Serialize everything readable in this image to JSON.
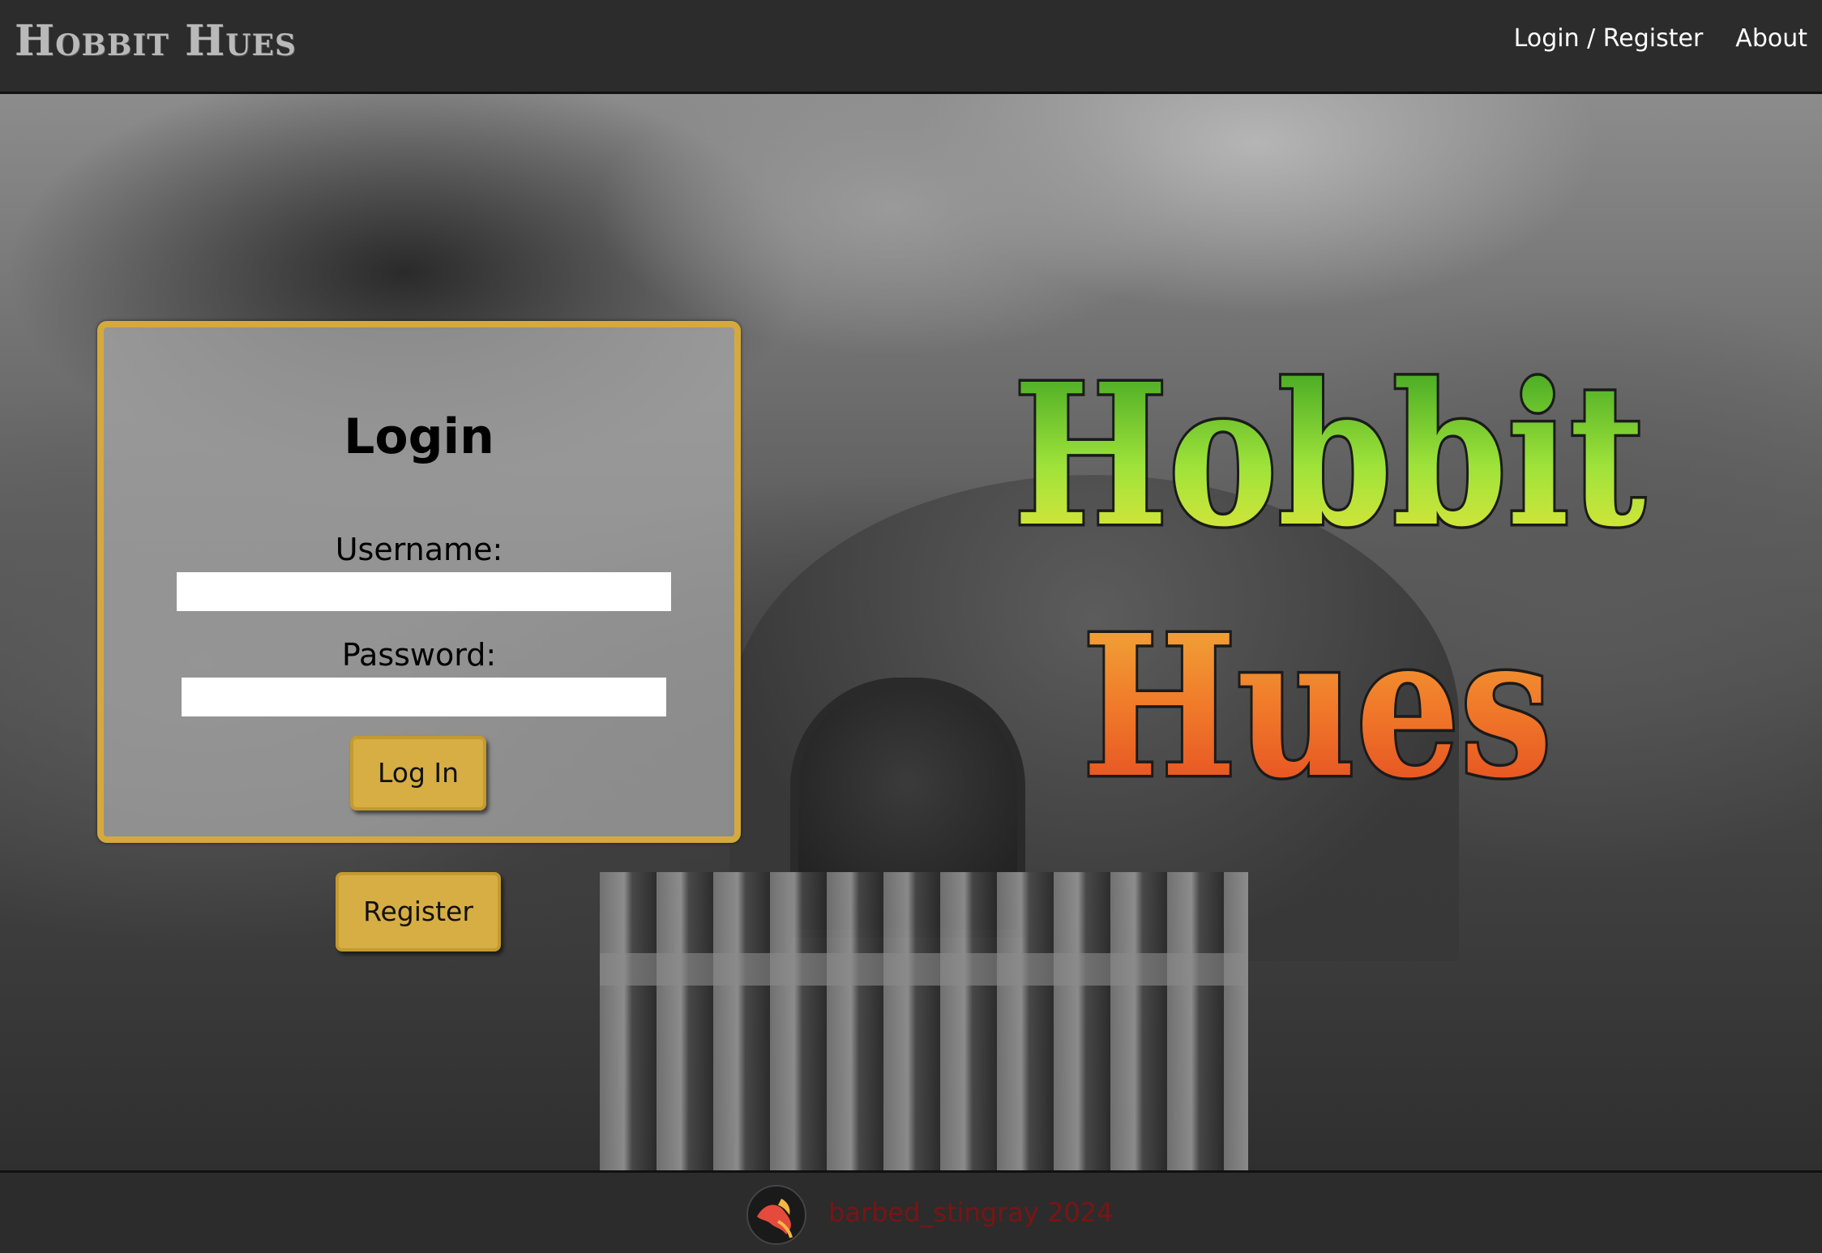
{
  "navbar": {
    "brand": "Hobbit Hues",
    "links": [
      {
        "label": "Login / Register"
      },
      {
        "label": "About"
      }
    ]
  },
  "hero": {
    "logo_line1": "Hobbit",
    "logo_line2": "Hues",
    "logo_colors": {
      "top_gradient": [
        "#2f9a1e",
        "#9fe33a",
        "#f1e53a"
      ],
      "bottom_gradient": [
        "#f0b23a",
        "#f07a2a",
        "#e2441e"
      ],
      "outline": "#1b1b1b"
    }
  },
  "login_form": {
    "title": "Login",
    "username_label": "Username:",
    "username_value": "",
    "password_label": "Password:",
    "password_value": "",
    "login_button": "Log In",
    "register_button": "Register",
    "border_color": "#d5a93d",
    "button_color": "#d7ae44"
  },
  "footer": {
    "text": "barbed_stingray 2024",
    "logo_icon": "stingray-logo-icon",
    "text_color": "#7a1414"
  }
}
